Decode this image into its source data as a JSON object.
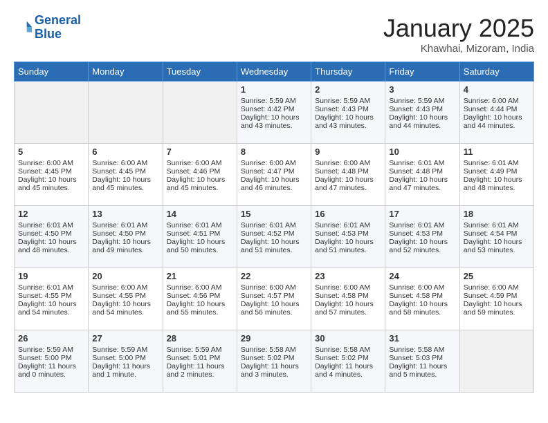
{
  "header": {
    "logo_line1": "General",
    "logo_line2": "Blue",
    "month": "January 2025",
    "location": "Khawhai, Mizoram, India"
  },
  "days_of_week": [
    "Sunday",
    "Monday",
    "Tuesday",
    "Wednesday",
    "Thursday",
    "Friday",
    "Saturday"
  ],
  "weeks": [
    [
      {
        "day": "",
        "content": ""
      },
      {
        "day": "",
        "content": ""
      },
      {
        "day": "",
        "content": ""
      },
      {
        "day": "1",
        "content": "Sunrise: 5:59 AM\nSunset: 4:42 PM\nDaylight: 10 hours and 43 minutes."
      },
      {
        "day": "2",
        "content": "Sunrise: 5:59 AM\nSunset: 4:43 PM\nDaylight: 10 hours and 43 minutes."
      },
      {
        "day": "3",
        "content": "Sunrise: 5:59 AM\nSunset: 4:43 PM\nDaylight: 10 hours and 44 minutes."
      },
      {
        "day": "4",
        "content": "Sunrise: 6:00 AM\nSunset: 4:44 PM\nDaylight: 10 hours and 44 minutes."
      }
    ],
    [
      {
        "day": "5",
        "content": "Sunrise: 6:00 AM\nSunset: 4:45 PM\nDaylight: 10 hours and 45 minutes."
      },
      {
        "day": "6",
        "content": "Sunrise: 6:00 AM\nSunset: 4:45 PM\nDaylight: 10 hours and 45 minutes."
      },
      {
        "day": "7",
        "content": "Sunrise: 6:00 AM\nSunset: 4:46 PM\nDaylight: 10 hours and 45 minutes."
      },
      {
        "day": "8",
        "content": "Sunrise: 6:00 AM\nSunset: 4:47 PM\nDaylight: 10 hours and 46 minutes."
      },
      {
        "day": "9",
        "content": "Sunrise: 6:00 AM\nSunset: 4:48 PM\nDaylight: 10 hours and 47 minutes."
      },
      {
        "day": "10",
        "content": "Sunrise: 6:01 AM\nSunset: 4:48 PM\nDaylight: 10 hours and 47 minutes."
      },
      {
        "day": "11",
        "content": "Sunrise: 6:01 AM\nSunset: 4:49 PM\nDaylight: 10 hours and 48 minutes."
      }
    ],
    [
      {
        "day": "12",
        "content": "Sunrise: 6:01 AM\nSunset: 4:50 PM\nDaylight: 10 hours and 48 minutes."
      },
      {
        "day": "13",
        "content": "Sunrise: 6:01 AM\nSunset: 4:50 PM\nDaylight: 10 hours and 49 minutes."
      },
      {
        "day": "14",
        "content": "Sunrise: 6:01 AM\nSunset: 4:51 PM\nDaylight: 10 hours and 50 minutes."
      },
      {
        "day": "15",
        "content": "Sunrise: 6:01 AM\nSunset: 4:52 PM\nDaylight: 10 hours and 51 minutes."
      },
      {
        "day": "16",
        "content": "Sunrise: 6:01 AM\nSunset: 4:53 PM\nDaylight: 10 hours and 51 minutes."
      },
      {
        "day": "17",
        "content": "Sunrise: 6:01 AM\nSunset: 4:53 PM\nDaylight: 10 hours and 52 minutes."
      },
      {
        "day": "18",
        "content": "Sunrise: 6:01 AM\nSunset: 4:54 PM\nDaylight: 10 hours and 53 minutes."
      }
    ],
    [
      {
        "day": "19",
        "content": "Sunrise: 6:01 AM\nSunset: 4:55 PM\nDaylight: 10 hours and 54 minutes."
      },
      {
        "day": "20",
        "content": "Sunrise: 6:00 AM\nSunset: 4:55 PM\nDaylight: 10 hours and 54 minutes."
      },
      {
        "day": "21",
        "content": "Sunrise: 6:00 AM\nSunset: 4:56 PM\nDaylight: 10 hours and 55 minutes."
      },
      {
        "day": "22",
        "content": "Sunrise: 6:00 AM\nSunset: 4:57 PM\nDaylight: 10 hours and 56 minutes."
      },
      {
        "day": "23",
        "content": "Sunrise: 6:00 AM\nSunset: 4:58 PM\nDaylight: 10 hours and 57 minutes."
      },
      {
        "day": "24",
        "content": "Sunrise: 6:00 AM\nSunset: 4:58 PM\nDaylight: 10 hours and 58 minutes."
      },
      {
        "day": "25",
        "content": "Sunrise: 6:00 AM\nSunset: 4:59 PM\nDaylight: 10 hours and 59 minutes."
      }
    ],
    [
      {
        "day": "26",
        "content": "Sunrise: 5:59 AM\nSunset: 5:00 PM\nDaylight: 11 hours and 0 minutes."
      },
      {
        "day": "27",
        "content": "Sunrise: 5:59 AM\nSunset: 5:00 PM\nDaylight: 11 hours and 1 minute."
      },
      {
        "day": "28",
        "content": "Sunrise: 5:59 AM\nSunset: 5:01 PM\nDaylight: 11 hours and 2 minutes."
      },
      {
        "day": "29",
        "content": "Sunrise: 5:58 AM\nSunset: 5:02 PM\nDaylight: 11 hours and 3 minutes."
      },
      {
        "day": "30",
        "content": "Sunrise: 5:58 AM\nSunset: 5:02 PM\nDaylight: 11 hours and 4 minutes."
      },
      {
        "day": "31",
        "content": "Sunrise: 5:58 AM\nSunset: 5:03 PM\nDaylight: 11 hours and 5 minutes."
      },
      {
        "day": "",
        "content": ""
      }
    ]
  ]
}
